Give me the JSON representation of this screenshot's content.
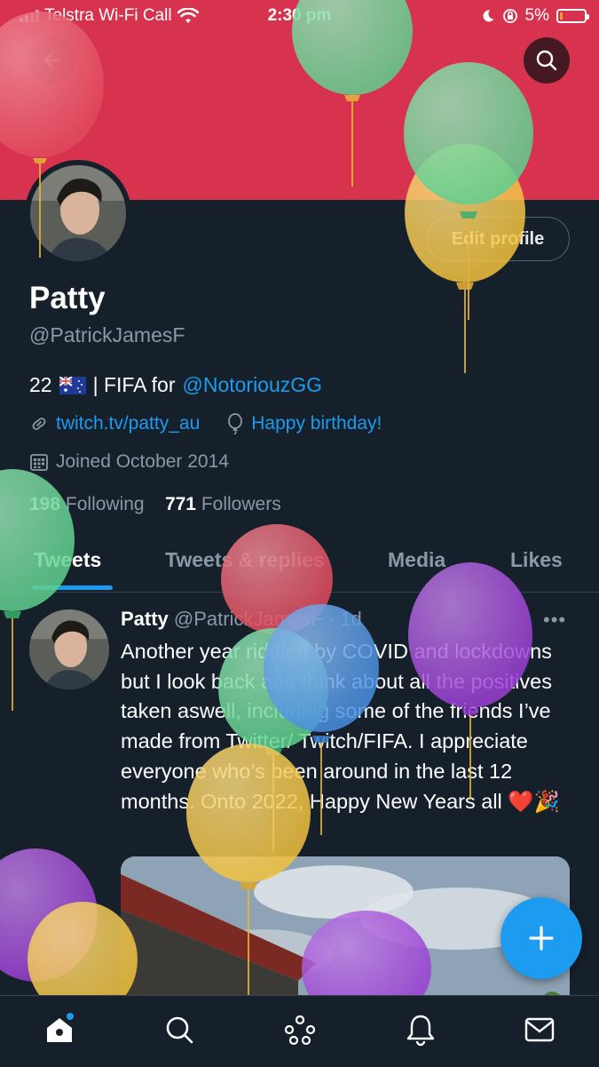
{
  "status_bar": {
    "carrier": "Telstra Wi-Fi Call",
    "time": "2:30 pm",
    "battery": "5%"
  },
  "profile": {
    "edit_label": "Edit profile",
    "name": "Patty",
    "handle": "@PatrickJamesF",
    "bio_prefix": "22",
    "bio_middle": "| FIFA for",
    "bio_mention": "@NotoriouzGG",
    "website": "twitch.tv/patty_au",
    "birthday": "Happy birthday!",
    "joined": "Joined October 2014",
    "following_count": "198",
    "following_label": "Following",
    "followers_count": "771",
    "followers_label": "Followers"
  },
  "tabs": [
    "Tweets",
    "Tweets & replies",
    "Media",
    "Likes"
  ],
  "tweet": {
    "name": "Patty",
    "handle": "@PatrickJamesF",
    "time": "1d",
    "text": "Another year riddled by COVID and lockdowns but I look back and think about all the positives taken aswell, including some of the friends I’ve made from Twitter/ Twitch/FIFA. I appreciate everyone who’s been around in the last 12 months. Onto 2022, Happy New Years all ❤️🎉"
  },
  "icons": {
    "back": "back-arrow-icon",
    "search": "search-icon",
    "link": "link-icon",
    "balloon": "balloon-icon",
    "calendar": "calendar-icon",
    "more": "more-icon",
    "compose": "plus-icon",
    "home": "home-icon",
    "explore": "search-icon",
    "spaces": "spaces-icon",
    "notifications": "bell-icon",
    "messages": "mail-icon"
  },
  "colors": {
    "background": "#15202b",
    "banner": "#d7334f",
    "accent": "#1d9bf0",
    "muted": "#8b98a5",
    "balloon_green": "#5fd08e",
    "balloon_yellow": "#f2c23e",
    "balloon_red": "#e24a5d",
    "balloon_blue": "#4a8fe0",
    "balloon_purple": "#9b3fd4"
  }
}
